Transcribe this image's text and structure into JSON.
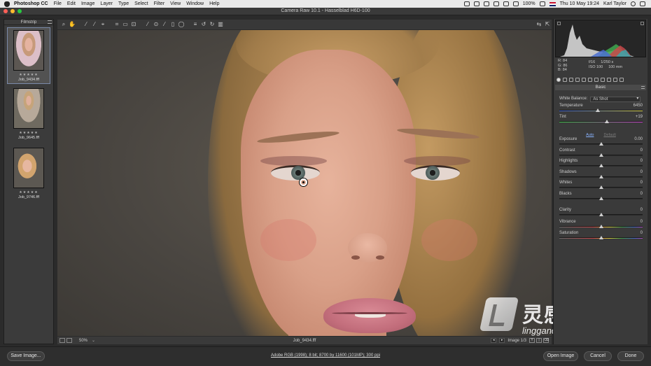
{
  "menubar": {
    "app": "Photoshop CC",
    "items": [
      "File",
      "Edit",
      "Image",
      "Layer",
      "Type",
      "Select",
      "Filter",
      "View",
      "Window",
      "Help"
    ],
    "battery": "100%",
    "clock": "Thu 10 May  19:24",
    "user": "Karl Taylor"
  },
  "window": {
    "title": "Camera Raw 10.1  -  Hasselblad H6D-100"
  },
  "filmstrip": {
    "title": "Filmstrip",
    "items": [
      {
        "stars": "★★★★★",
        "name": "Job_9434.fff",
        "selected": true
      },
      {
        "stars": "★★★★★",
        "name": "Job_9645.fff",
        "selected": false
      },
      {
        "stars": "★★★★★",
        "name": "Job_9746.fff",
        "selected": false
      }
    ]
  },
  "status": {
    "zoom": "50%",
    "zoom_menu": "⌄",
    "filename": "Job_9434.fff",
    "prev": "◂",
    "next": "▸",
    "image_counter": "Image 1/3",
    "flag_y": "Y",
    "flag_b": "|",
    "flag_del": "⌫"
  },
  "histogram": {
    "readout": {
      "r": "R:  84",
      "g": "G:  86",
      "b": "B:  84"
    },
    "camera": {
      "aperture": "f/16",
      "shutter": "1/250 s",
      "iso": "ISO 100",
      "focal": "100 mm"
    }
  },
  "basic": {
    "title": "Basic",
    "white_balance_label": "White Balance:",
    "white_balance_value": "As Shot",
    "auto_label": "Auto",
    "default_label": "Default",
    "sliders": [
      {
        "key": "temperature",
        "label": "Temperature",
        "value": "6450",
        "position": 0.46
      },
      {
        "key": "tint",
        "label": "Tint",
        "value": "+19",
        "position": 0.57
      },
      {
        "key": "exposure",
        "label": "Exposure",
        "value": "0.00",
        "position": 0.5
      },
      {
        "key": "contrast",
        "label": "Contrast",
        "value": "0",
        "position": 0.5
      },
      {
        "key": "highlights",
        "label": "Highlights",
        "value": "0",
        "position": 0.5
      },
      {
        "key": "shadows",
        "label": "Shadows",
        "value": "0",
        "position": 0.5
      },
      {
        "key": "whites",
        "label": "Whites",
        "value": "0",
        "position": 0.5
      },
      {
        "key": "blacks",
        "label": "Blacks",
        "value": "0",
        "position": 0.5
      },
      {
        "key": "clarity",
        "label": "Clarity",
        "value": "0",
        "position": 0.5
      },
      {
        "key": "vibrance",
        "label": "Vibrance",
        "value": "0",
        "position": 0.5
      },
      {
        "key": "saturation",
        "label": "Saturation",
        "value": "0",
        "position": 0.5
      }
    ]
  },
  "footer": {
    "save_label": "Save Image...",
    "workflow": "Adobe RGB (1998); 8 bit; 8700 by 11600 (101MP); 300 ppi",
    "open_label": "Open Image",
    "cancel_label": "Cancel",
    "done_label": "Done"
  },
  "watermark": {
    "cn": "灵感中国",
    "url": "lingganchina.com"
  },
  "colors": {
    "menubar": "#e9e9e9",
    "panel": "#3a3a3a",
    "canvas_bg": "#4a4641",
    "accent_link": "#8ab4ff"
  }
}
